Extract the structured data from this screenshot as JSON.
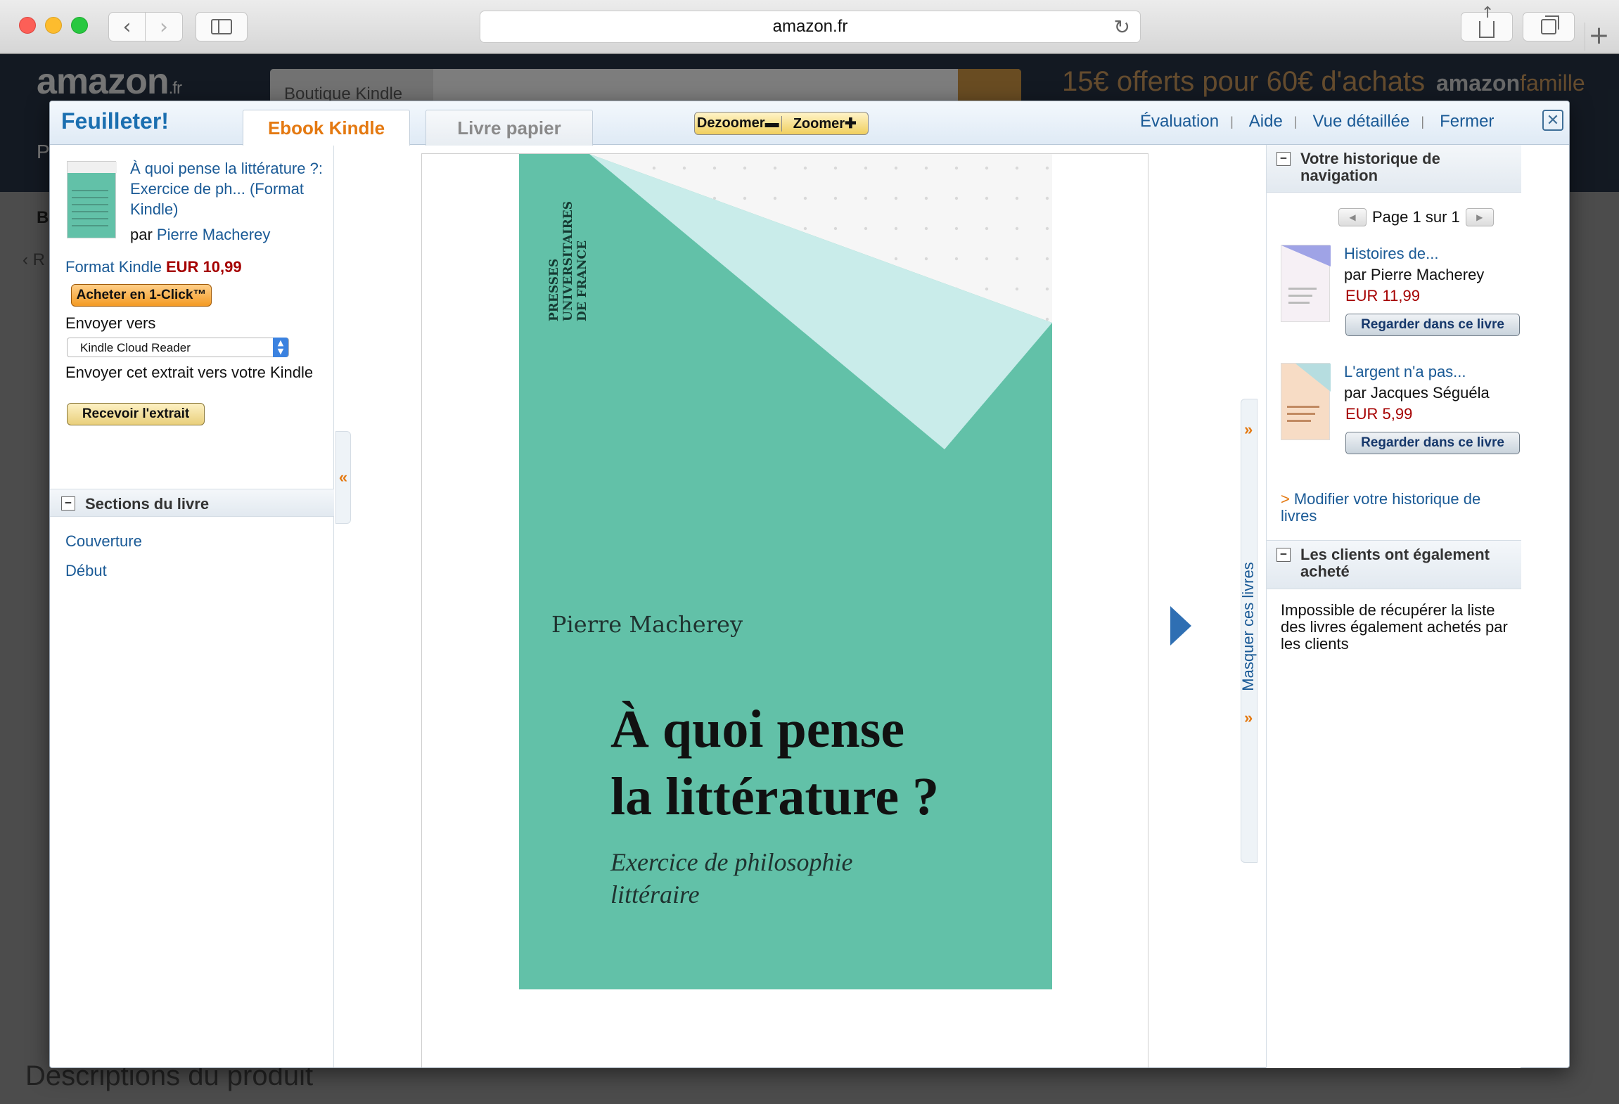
{
  "browser": {
    "url": "amazon.fr"
  },
  "background": {
    "logo": "amazon",
    "logo_suffix": ".fr",
    "search_category": "Boutique Kindle",
    "promo": "15€ offerts pour 60€ d'achats",
    "famille_brand": "amazon",
    "famille_suffix": "famille",
    "left_fragment_1": "P",
    "left_fragment_2": "B",
    "left_fragment_3": "‹ R",
    "descriptions_heading": "Descriptions du produit"
  },
  "modal": {
    "brand": "Feuilleter!",
    "tabs": [
      {
        "label": "Ebook Kindle",
        "active": true
      },
      {
        "label": "Livre papier",
        "active": false
      }
    ],
    "zoom_out": "Dezoomer",
    "zoom_in": "Zoomer",
    "header_links": [
      "Évaluation",
      "Aide",
      "Vue détaillée",
      "Fermer"
    ],
    "close_glyph": "✕"
  },
  "book": {
    "title": "À quoi pense la littérature ?: Exercice de ph... (Format Kindle)",
    "author_prefix": "par",
    "author": "Pierre Macherey",
    "format_label": "Format Kindle",
    "price": "EUR 10,99",
    "buy_button": "Acheter en 1-Click™",
    "send_to_label": "Envoyer vers",
    "send_to_selected": "Kindle Cloud Reader",
    "extract_label": "Envoyer cet extrait vers votre Kindle",
    "extract_button": "Recevoir l'extrait"
  },
  "sections": {
    "heading": "Sections du livre",
    "items": [
      "Couverture",
      "Début"
    ]
  },
  "cover": {
    "publisher_lines": [
      "PRESSES",
      "UNIVERSITAIRES",
      "DE FRANCE"
    ],
    "author": "Pierre Macherey",
    "title_lines": [
      "À quoi pense",
      "la littérature ?"
    ],
    "subtitle_lines": [
      "Exercice de philosophie",
      "littéraire"
    ],
    "colors": {
      "background": "#62c1a8",
      "triangle": "#c9ecea",
      "dots": "#f6f6f6"
    }
  },
  "side_handles": {
    "left_arrow": "«",
    "right_arrow": "»",
    "hide_books": "Masquer ces livres"
  },
  "history": {
    "heading": "Votre historique de navigation",
    "page_label": "Page 1 sur 1",
    "items": [
      {
        "title": "Histoires de...",
        "author": "par Pierre Macherey",
        "price": "EUR 11,99",
        "button": "Regarder dans ce livre"
      },
      {
        "title": "L'argent n'a pas...",
        "author": "par Jacques Séguéla",
        "price": "EUR 5,99",
        "button": "Regarder dans ce livre"
      }
    ],
    "modify_link": "Modifier votre historique de livres"
  },
  "also_bought": {
    "heading": "Les clients ont également acheté",
    "message": "Impossible de récupérer la liste des livres également achetés par les clients"
  }
}
